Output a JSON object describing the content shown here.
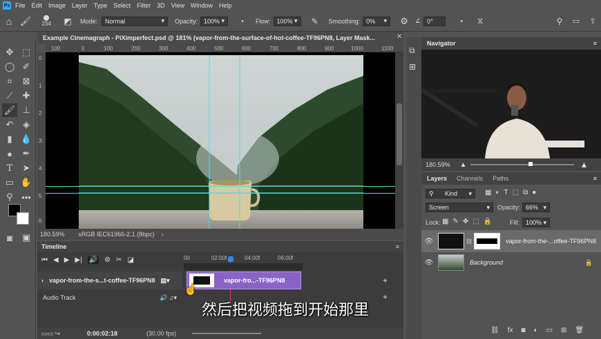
{
  "app": {
    "logo": "Ps",
    "menu": [
      "File",
      "Edit",
      "Image",
      "Layer",
      "Type",
      "Select",
      "Filter",
      "3D",
      "View",
      "Window",
      "Help"
    ]
  },
  "options": {
    "brush_size": "234",
    "mode_label": "Mode:",
    "mode_value": "Normal",
    "opacity_label": "Opacity:",
    "opacity_value": "100%",
    "flow_label": "Flow:",
    "flow_value": "100%",
    "smoothing_label": "Smoothing:",
    "smoothing_value": "0%",
    "angle_value": "0°"
  },
  "document": {
    "tab_title": "Example Cinemagraph - PiXimperfect.psd @ 181% (vapor-from-the-surface-of-hot-coffee-TF96PN8, Layer Mask...",
    "ruler_h": [
      "100",
      "0",
      "100",
      "200",
      "300",
      "400",
      "500",
      "600",
      "700",
      "800",
      "900",
      "1000",
      "1100"
    ],
    "ruler_v": [
      "0",
      "1",
      "2",
      "3",
      "4",
      "5",
      "6"
    ],
    "zoom": "180.59%",
    "profile": "sRGB IEC61966-2.1 (8bpc)"
  },
  "timeline": {
    "title": "Timeline",
    "time_marks": [
      "00",
      "02:00f",
      "04:00f",
      "06:00f"
    ],
    "track_name": "vapor-from-the-s...t-coffee-TF96PN8",
    "clip_label": "vapor-fro...-TF96PN8",
    "audio_label": "Audio Track",
    "timecode": "0:00:02:18",
    "fps": "(30.00 fps)"
  },
  "navigator": {
    "title": "Navigator",
    "zoom": "180.59%"
  },
  "layers": {
    "tabs": [
      "Layers",
      "Channels",
      "Paths"
    ],
    "kind": "Kind",
    "blend": "Screen",
    "opacity_label": "Opacity:",
    "opacity_value": "66%",
    "lock_label": "Lock:",
    "fill_label": "Fill:",
    "fill_value": "100%",
    "items": [
      {
        "name": "vapor-from-the-...offee-TF96PN8"
      },
      {
        "name": "Background"
      }
    ]
  },
  "subtitle": "然后把视频拖到开始那里"
}
